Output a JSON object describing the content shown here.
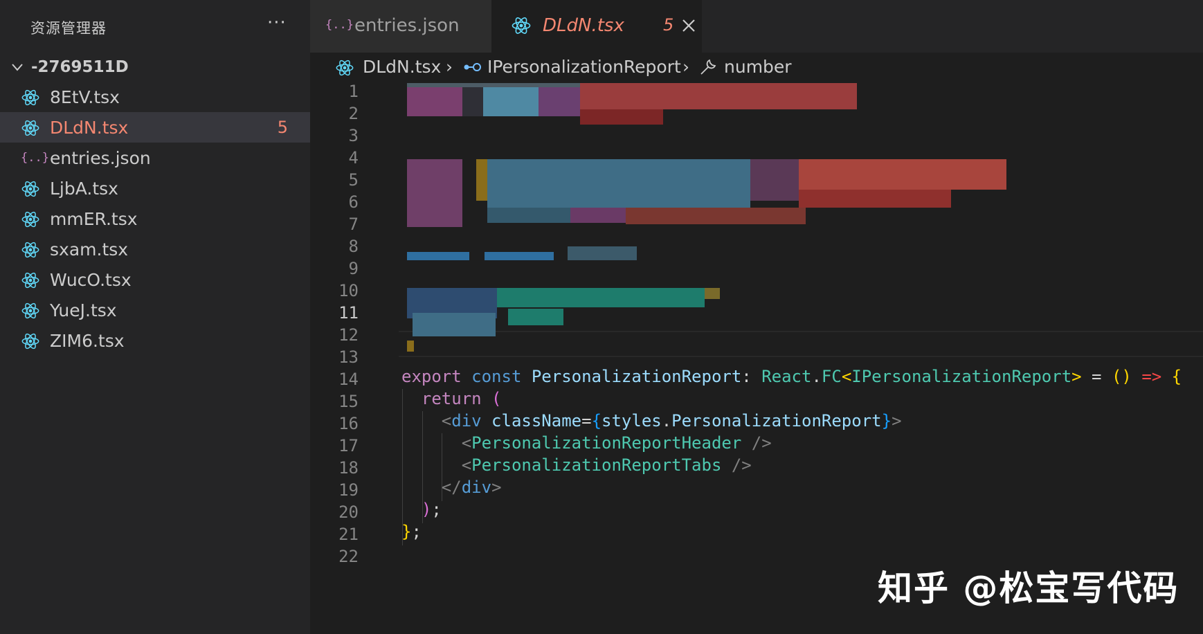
{
  "sidebar": {
    "title": "资源管理器",
    "more": "···",
    "folder": "-2769511D",
    "files": [
      {
        "name": "8EtV.tsx",
        "icon": "react-icon"
      },
      {
        "name": "DLdN.tsx",
        "icon": "react-icon",
        "badge": "5",
        "active": true
      },
      {
        "name": "entries.json",
        "icon": "json-icon"
      },
      {
        "name": "LjbA.tsx",
        "icon": "react-icon"
      },
      {
        "name": "mmER.tsx",
        "icon": "react-icon"
      },
      {
        "name": "sxam.tsx",
        "icon": "react-icon"
      },
      {
        "name": "WucO.tsx",
        "icon": "react-icon"
      },
      {
        "name": "YueJ.tsx",
        "icon": "react-icon"
      },
      {
        "name": "ZIM6.tsx",
        "icon": "react-icon"
      }
    ]
  },
  "tabs": [
    {
      "label": "entries.json",
      "icon": "json-icon"
    },
    {
      "label": "DLdN.tsx",
      "badge": "5",
      "icon": "react-icon",
      "active": true
    }
  ],
  "breadcrumb": {
    "file": "DLdN.tsx",
    "interface": "IPersonalizationReport",
    "property": "number"
  },
  "editor": {
    "line_numbers": [
      "1",
      "2",
      "3",
      "4",
      "5",
      "6",
      "7",
      "8",
      "9",
      "10",
      "11",
      "12",
      "13",
      "14",
      "15",
      "16",
      "17",
      "18",
      "19",
      "20",
      "21",
      "22"
    ],
    "current_line": "11",
    "code": {
      "l14": {
        "export": "export",
        "const": "const",
        "name": "PersonalizationReport",
        "colon": ": ",
        "react": "React",
        "dot": ".",
        "fc": "FC",
        "lt": "<",
        "iface": "IPersonalizationReport",
        "gt": ">",
        "eq": " = ",
        "parens": "()",
        "arrow": " =>",
        "brace": " {"
      },
      "l15": {
        "return": "return",
        "paren": " ("
      },
      "l16": {
        "open": "<",
        "tag": "div",
        "attr": " className",
        "eq": "=",
        "lbrace": "{",
        "obj": "styles",
        "dot": ".",
        "prop": "PersonalizationReport",
        "rbrace": "}",
        "close": ">"
      },
      "l17": {
        "open": "<",
        "tag": "PersonalizationReportHeader",
        "close": " />"
      },
      "l18": {
        "open": "<",
        "tag": "PersonalizationReportTabs",
        "close": " />"
      },
      "l19": {
        "open": "</",
        "tag": "div",
        "close": ">"
      },
      "l20": {
        "paren": ")",
        "semi": ";"
      },
      "l21": {
        "brace": "}",
        "semi": ";"
      }
    }
  },
  "watermark": "知乎 @松宝写代码",
  "colors": {
    "error": "#f48771",
    "react": "#61dafb",
    "keyword_pink": "#c586c0",
    "keyword_blue": "#569cd6",
    "type_green": "#4ec9b0"
  }
}
